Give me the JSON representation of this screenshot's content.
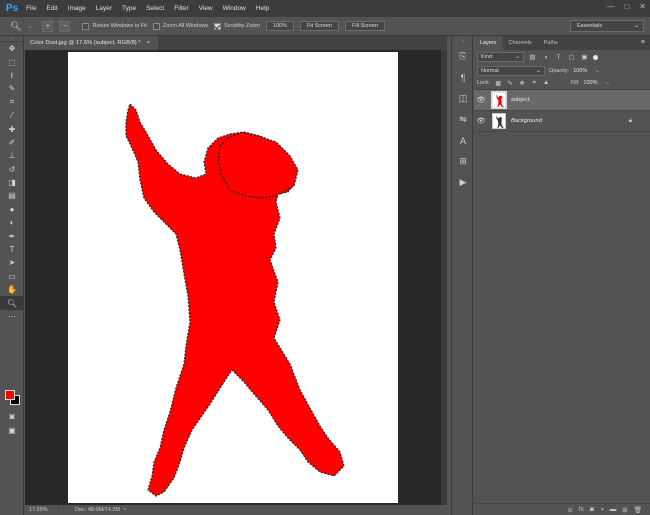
{
  "app": {
    "logo": "Ps",
    "menu": [
      "File",
      "Edit",
      "Image",
      "Layer",
      "Type",
      "Select",
      "Filter",
      "View",
      "Window",
      "Help"
    ],
    "window_controls": [
      "—",
      "□",
      "✕"
    ]
  },
  "options_bar": {
    "resize_windows": {
      "label": "Resize Windows to Fit",
      "checked": false
    },
    "zoom_all": {
      "label": "Zoom All Windows",
      "checked": false
    },
    "scrubby_zoom": {
      "label": "Scrubby Zoom",
      "checked": true
    },
    "btn_100": "100%",
    "btn_fit": "Fit Screen",
    "btn_fill": "Fill Screen",
    "workspace": "Essentials"
  },
  "document": {
    "tab_title": "Color Dust.jpg @ 17.6% (subject, RGB/8) *",
    "close_glyph": "×",
    "zoom": "17.55%",
    "doc_info": "Doc: 48.0M/74.3M",
    "status_arrow": "›",
    "silhouette_color": "#ff0000"
  },
  "colors": {
    "foreground": "#ff0000",
    "background": "#000000"
  },
  "panel": {
    "tabs": [
      "Layers",
      "Channels",
      "Paths"
    ],
    "kind_label": "Kind",
    "blend_mode": "Normal",
    "opacity_label": "Opacity:",
    "opacity_value": "100%",
    "lock_label": "Lock:",
    "fill_label": "Fill:",
    "fill_value": "100%",
    "layers": [
      {
        "name": "subject",
        "selected": true,
        "visible": true,
        "locked": false
      },
      {
        "name": "Background",
        "selected": false,
        "visible": true,
        "locked": true
      }
    ]
  }
}
